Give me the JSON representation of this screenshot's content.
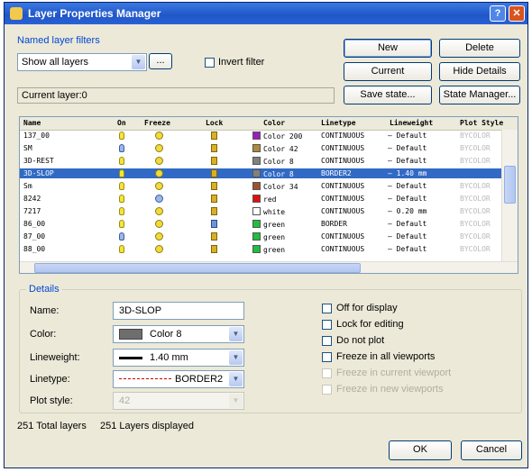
{
  "window": {
    "title": "Layer Properties Manager",
    "help": "?",
    "close": "✕"
  },
  "filters": {
    "label": "Named layer filters",
    "combo_value": "Show all layers",
    "browse_btn": "...",
    "invert_label": "Invert filter"
  },
  "current_layer_text": "Current layer:0",
  "buttons": {
    "new": "New",
    "delete": "Delete",
    "current": "Current",
    "hide_details": "Hide Details",
    "save_state": "Save state...",
    "state_manager": "State Manager...",
    "ok": "OK",
    "cancel": "Cancel"
  },
  "table": {
    "headers": [
      "Name",
      "On",
      "Freeze",
      "Lock",
      "Color",
      "Linetype",
      "Lineweight",
      "Plot Style"
    ],
    "rows": [
      {
        "name": "137_00",
        "color_hex": "#9b1fbd",
        "color_name": "Color 200",
        "linetype": "CONTINUOUS",
        "lineweight": "— Default",
        "plot_style": "BYCOLOR",
        "on": "on",
        "freeze": "thawed",
        "lock": "locked",
        "selected": false
      },
      {
        "name": "SM",
        "color_hex": "#b0893a",
        "color_name": "Color 42",
        "linetype": "CONTINUOUS",
        "lineweight": "— Default",
        "plot_style": "BYCOLOR",
        "on": "off",
        "freeze": "thawed",
        "lock": "locked",
        "selected": false
      },
      {
        "name": "3D-REST",
        "color_hex": "#808080",
        "color_name": "Color 8",
        "linetype": "CONTINUOUS",
        "lineweight": "— Default",
        "plot_style": "BYCOLOR",
        "on": "on",
        "freeze": "thawed",
        "lock": "locked",
        "selected": false
      },
      {
        "name": "3D-SLOP",
        "color_hex": "#808080",
        "color_name": "Color 8",
        "linetype": "BORDER2",
        "lineweight": "— 1.40 mm",
        "plot_style": "",
        "on": "on",
        "freeze": "thawed",
        "lock": "locked",
        "selected": true
      },
      {
        "name": "Sm",
        "color_hex": "#a0522d",
        "color_name": "Color 34",
        "linetype": "CONTINUOUS",
        "lineweight": "— Default",
        "plot_style": "BYCOLOR",
        "on": "on",
        "freeze": "thawed",
        "lock": "locked",
        "selected": false
      },
      {
        "name": "8242",
        "color_hex": "#e01010",
        "color_name": "red",
        "linetype": "CONTINUOUS",
        "lineweight": "— Default",
        "plot_style": "BYCOLOR",
        "on": "on",
        "freeze": "frozen",
        "lock": "locked",
        "selected": false
      },
      {
        "name": "7217",
        "color_hex": "#ffffff",
        "color_name": "white",
        "linetype": "CONTINUOUS",
        "lineweight": "— 0.20 mm",
        "plot_style": "BYCOLOR",
        "on": "on",
        "freeze": "thawed",
        "lock": "locked",
        "selected": false
      },
      {
        "name": "86_00",
        "color_hex": "#1fbf3f",
        "color_name": "green",
        "linetype": "BORDER",
        "lineweight": "— Default",
        "plot_style": "BYCOLOR",
        "on": "on",
        "freeze": "thawed",
        "lock": "unlocked",
        "selected": false
      },
      {
        "name": "87_00",
        "color_hex": "#1fbf3f",
        "color_name": "green",
        "linetype": "CONTINUOUS",
        "lineweight": "— Default",
        "plot_style": "BYCOLOR",
        "on": "off",
        "freeze": "thawed",
        "lock": "locked",
        "selected": false
      },
      {
        "name": "88_00",
        "color_hex": "#1fbf3f",
        "color_name": "green",
        "linetype": "CONTINUOUS",
        "lineweight": "— Default",
        "plot_style": "BYCOLOR",
        "on": "on",
        "freeze": "thawed",
        "lock": "locked",
        "selected": false
      }
    ]
  },
  "details": {
    "title": "Details",
    "name_label": "Name:",
    "name_value": "3D-SLOP",
    "color_label": "Color:",
    "color_value": "Color 8",
    "color_swatch": "#6e6e6e",
    "lineweight_label": "Lineweight:",
    "lineweight_value": "1.40 mm",
    "linetype_label": "Linetype:",
    "linetype_value": "BORDER2",
    "plotstyle_label": "Plot style:",
    "plotstyle_value": "42",
    "checks": [
      {
        "label": "Off for display",
        "enabled": true
      },
      {
        "label": "Lock for editing",
        "enabled": true
      },
      {
        "label": "Do not plot",
        "enabled": true
      },
      {
        "label": "Freeze in all viewports",
        "enabled": true
      },
      {
        "label": "Freeze in current viewport",
        "enabled": false
      },
      {
        "label": "Freeze in new viewports",
        "enabled": false
      }
    ]
  },
  "status": {
    "total": "251 Total layers",
    "displayed": "251 Layers displayed"
  }
}
